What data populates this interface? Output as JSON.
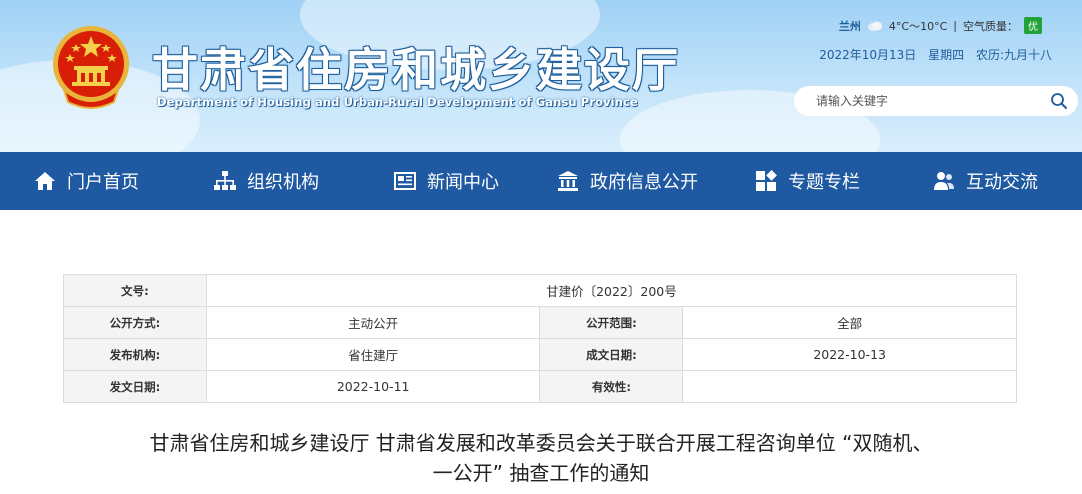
{
  "header": {
    "title": "甘肃省住房和城乡建设厅",
    "subtitle": "Department of Housing and Urban-Rural Development of Gansu Province",
    "weather": {
      "city": "兰州",
      "icon": "cloudy-icon",
      "temperature": "4°C～10°C",
      "separator": "|",
      "air_quality_label": "空气质量：",
      "air_quality_value": "优"
    },
    "date": {
      "gregorian": "2022年10月13日",
      "weekday": "星期四",
      "lunar": "农历:九月十八"
    },
    "search": {
      "placeholder": "请输入关键字"
    }
  },
  "nav": {
    "items": [
      {
        "label": "门户首页",
        "icon": "home-icon"
      },
      {
        "label": "组织机构",
        "icon": "org-chart-icon"
      },
      {
        "label": "新闻中心",
        "icon": "newspaper-icon"
      },
      {
        "label": "政府信息公开",
        "icon": "government-building-icon"
      },
      {
        "label": "专题专栏",
        "icon": "grid-icon"
      },
      {
        "label": "互动交流",
        "icon": "users-icon"
      }
    ]
  },
  "meta": {
    "doc_no_label": "文号:",
    "doc_no": "甘建价〔2022〕200号",
    "disclosure_label": "公开方式:",
    "disclosure": "主动公开",
    "scope_label": "公开范围:",
    "scope": "全部",
    "publisher_label": "发布机构:",
    "publisher": "省住建厅",
    "created_label": "成文日期:",
    "created": "2022-10-13",
    "issued_label": "发文日期:",
    "issued": "2022-10-11",
    "validity_label": "有效性:",
    "validity": ""
  },
  "article": {
    "title_line1": "甘肃省住房和城乡建设厅 甘肃省发展和改革委员会关于联合开展工程咨询单位 “双随机、",
    "title_line2": "一公开” 抽查工作的通知"
  },
  "colors": {
    "nav_bg": "#1e59a1",
    "header_bg": "#9fd1f5",
    "air_quality_good": "#21a33a"
  }
}
